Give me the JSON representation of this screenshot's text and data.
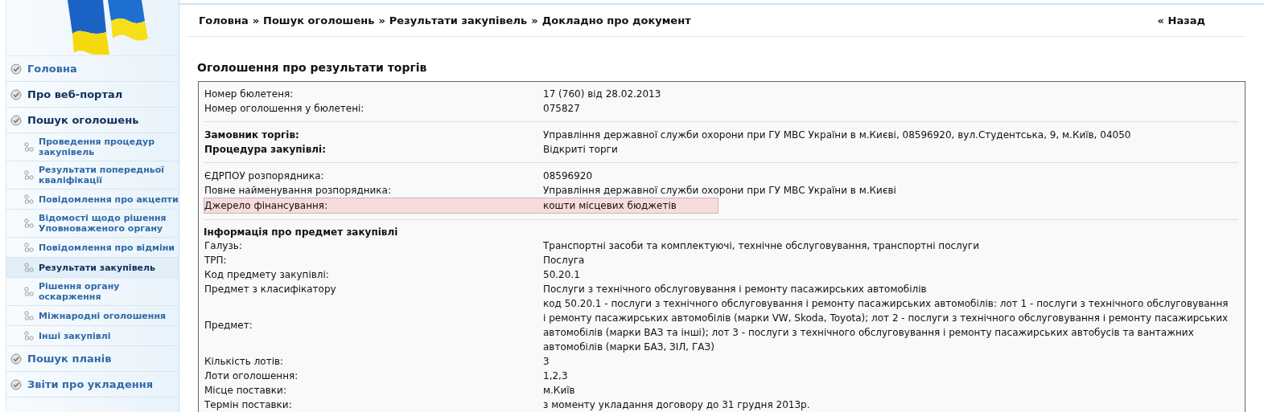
{
  "sidebar": {
    "items": [
      {
        "label": "Головна",
        "kind": "main",
        "active": false
      },
      {
        "label": "Про веб-портал",
        "kind": "main",
        "active": true
      },
      {
        "label": "Пошук оголошень",
        "kind": "main",
        "active": true
      },
      {
        "label": "Проведення процедур закупівель",
        "kind": "sub",
        "active": false
      },
      {
        "label": "Результати попередньої кваліфікації",
        "kind": "sub",
        "active": false
      },
      {
        "label": "Повідомлення про акцепти",
        "kind": "sub",
        "active": false
      },
      {
        "label": "Відомості щодо рішення Уповноваженого органу",
        "kind": "sub",
        "active": false
      },
      {
        "label": "Повідомлення про відміни",
        "kind": "sub",
        "active": false
      },
      {
        "label": "Результати закупівель",
        "kind": "sub",
        "active": true
      },
      {
        "label": "Рішення органу оскарження",
        "kind": "sub",
        "active": false
      },
      {
        "label": "Міжнародні оголошення",
        "kind": "sub",
        "active": false
      },
      {
        "label": "Інші закупівлі",
        "kind": "sub",
        "active": false
      },
      {
        "label": "Пошук планів",
        "kind": "main",
        "active": false
      },
      {
        "label": "Звіти про укладення",
        "kind": "main",
        "active": false
      }
    ]
  },
  "breadcrumb": [
    "Головна",
    "Пошук оголошень",
    "Результати закупівель",
    "Докладно про документ"
  ],
  "breadcrumb_separators": [
    "»",
    "»",
    "»"
  ],
  "back_link": "« Назад",
  "title": "Оголошення про результати торгів",
  "sections": [
    {
      "rows": [
        {
          "label": "Номер бюлетеня:",
          "value": "17 (760) від 28.02.2013",
          "emphasized": false,
          "highlighted": false
        },
        {
          "label": "Номер оголошення у бюлетені:",
          "value": "075827",
          "emphasized": false,
          "highlighted": false
        }
      ]
    },
    {
      "rows": [
        {
          "label": "Замовник торгів:",
          "value": "Управління державної служби охорони при ГУ МВС України в м.Києві, 08596920, вул.Студентська, 9, м.Київ, 04050",
          "emphasized": true,
          "highlighted": false
        },
        {
          "label": "Процедура закупівлі:",
          "value": "Відкриті торги",
          "emphasized": true,
          "highlighted": false
        }
      ]
    },
    {
      "rows": [
        {
          "label": "ЄДРПОУ розпорядника:",
          "value": "08596920",
          "emphasized": false,
          "highlighted": false
        },
        {
          "label": "Повне найменування розпорядника:",
          "value": "Управління державної служби охорони при ГУ МВС України в м.Києві",
          "emphasized": false,
          "highlighted": false
        },
        {
          "label": "Джерело фінансування:",
          "value": "кошти місцевих бюджетів",
          "emphasized": false,
          "highlighted": true
        }
      ]
    },
    {
      "heading": "Інформація про предмет закупівлі",
      "rows": [
        {
          "label": "Галузь:",
          "value": "Транспортні засоби та комплектуючі, технічне обслуговування, транспортні послуги",
          "emphasized": false,
          "highlighted": false
        },
        {
          "label": "ТРП:",
          "value": "Послуга",
          "emphasized": false,
          "highlighted": false
        },
        {
          "label": "Код предмету закупівлі:",
          "value": "50.20.1",
          "emphasized": false,
          "highlighted": false
        },
        {
          "label": "Предмет з класифікатору",
          "value": "Послуги з технічного обслуговування і ремонту пасажирських автомобілів",
          "emphasized": false,
          "highlighted": false
        },
        {
          "label": "Предмет:",
          "value": "код 50.20.1 - послуги з технічного обслуговування і ремонту пасажирських автомобілів: лот 1 - послуги з технічного обслуговування і ремонту пасажирських автомобілів (марки VW, Skoda, Toyota); лот 2 - послуги з технічного обслуговування і ремонту пасажирських автомобілів (марки ВАЗ та інші); лот 3 - послуги з технічного обслуговування і ремонту пасажирських автобусів та вантажних автомобілів (марки БАЗ, ЗІЛ, ГАЗ)",
          "emphasized": false,
          "highlighted": false
        },
        {
          "label": "Кількість лотів:",
          "value": "3",
          "emphasized": false,
          "highlighted": false
        },
        {
          "label": "Лоти оголошення:",
          "value": "1,2,3",
          "emphasized": false,
          "highlighted": false
        },
        {
          "label": "Місце поставки:",
          "value": "м.Київ",
          "emphasized": false,
          "highlighted": false
        },
        {
          "label": "Термін поставки:",
          "value": "з моменту укладання договору до 31 грудня 2013р.",
          "emphasized": false,
          "highlighted": false
        }
      ]
    }
  ]
}
